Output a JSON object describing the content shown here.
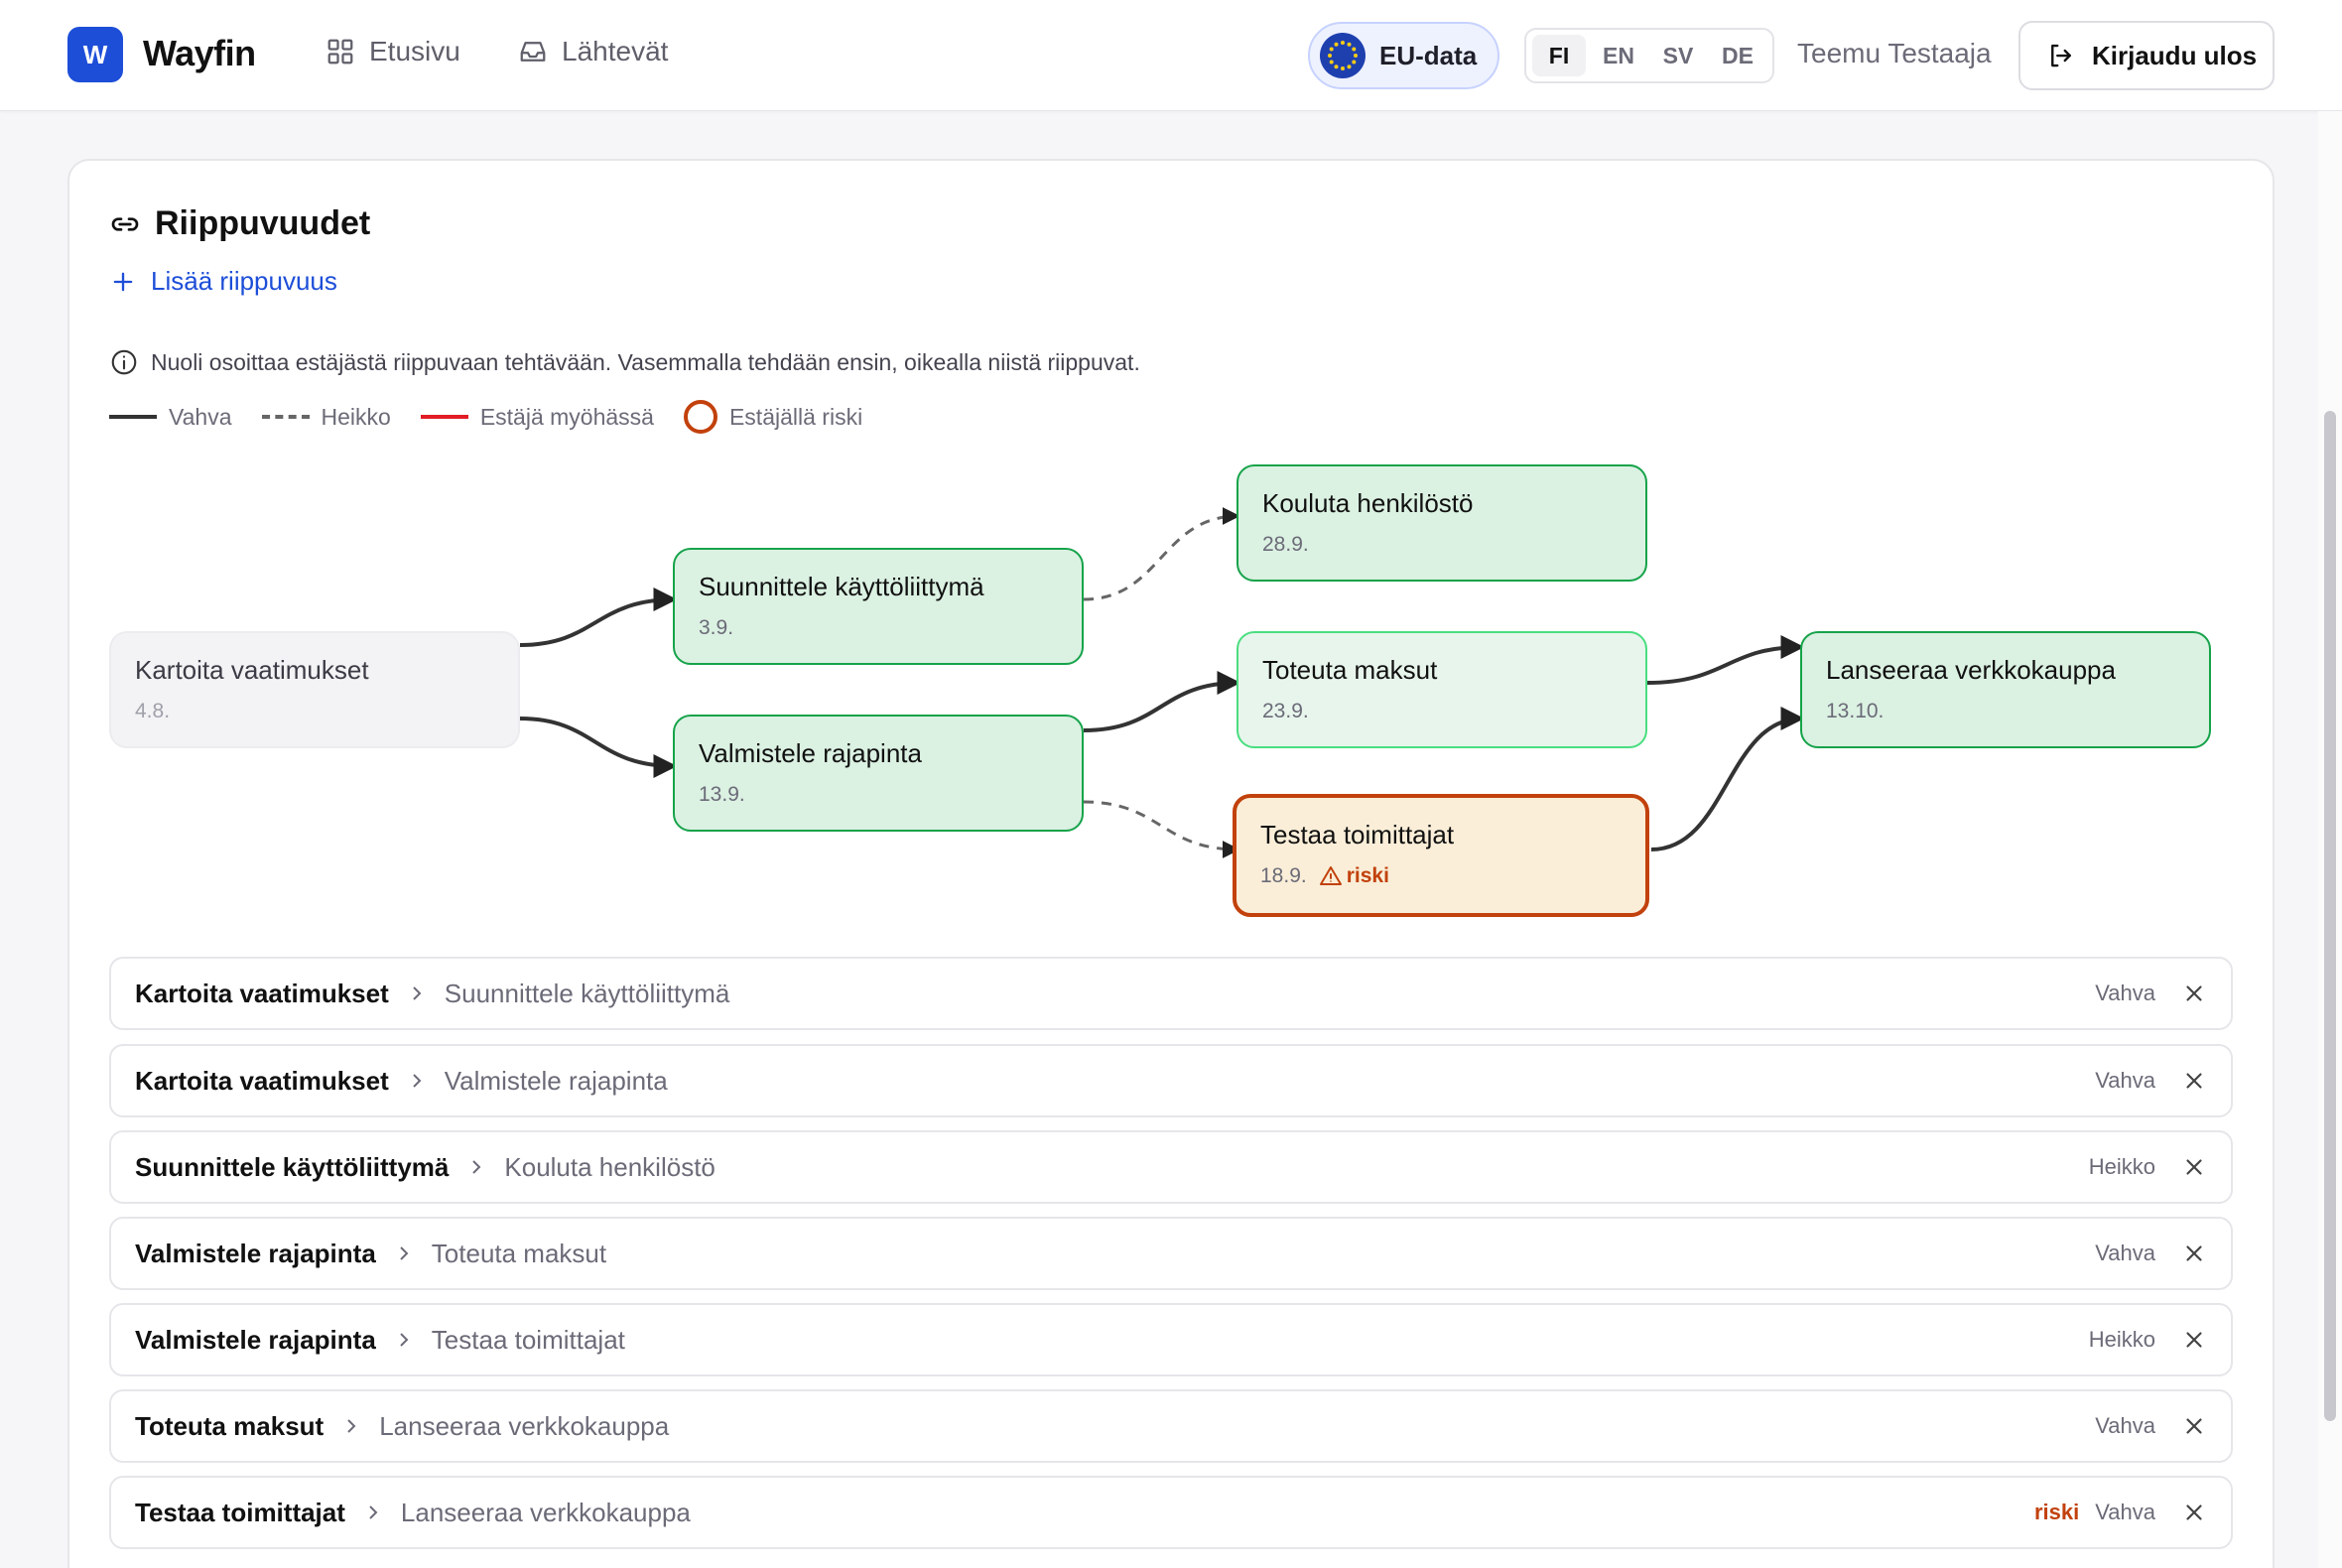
{
  "header": {
    "logo_letter": "W",
    "brand": "Wayfin",
    "nav": [
      {
        "label": "Etusivu",
        "icon": "grid-icon"
      },
      {
        "label": "Lähtevät",
        "icon": "inbox-icon"
      }
    ],
    "eu_badge": "EU-data",
    "languages": [
      {
        "code": "FI",
        "active": true
      },
      {
        "code": "EN",
        "active": false
      },
      {
        "code": "SV",
        "active": false
      },
      {
        "code": "DE",
        "active": false
      }
    ],
    "user_name": "Teemu Testaaja",
    "logout_label": "Kirjaudu ulos"
  },
  "section": {
    "title": "Riippuvuudet",
    "add_label": "Lisää riippuvuus",
    "info_text": "Nuoli osoittaa estäjästä riippuvaan tehtävään. Vasemmalla tehdään ensin, oikealla niistä riippuvat.",
    "legend": {
      "strong": "Vahva",
      "weak": "Heikko",
      "late": "Estäjä myöhässä",
      "risk": "Estäjällä riski"
    }
  },
  "graph": {
    "nodes": [
      {
        "id": "kartoita",
        "title": "Kartoita vaatimukset",
        "date": "4.8.",
        "status": "done"
      },
      {
        "id": "suunnittele",
        "title": "Suunnittele käyttöliittymä",
        "date": "3.9.",
        "status": "ok"
      },
      {
        "id": "valmistele",
        "title": "Valmistele rajapinta",
        "date": "13.9.",
        "status": "ok"
      },
      {
        "id": "kouluta",
        "title": "Kouluta henkilöstö",
        "date": "28.9.",
        "status": "ok"
      },
      {
        "id": "toteuta",
        "title": "Toteuta maksut",
        "date": "23.9.",
        "status": "light"
      },
      {
        "id": "testaa",
        "title": "Testaa toimittajat",
        "date": "18.9.",
        "status": "risk",
        "risk_label": "riski"
      },
      {
        "id": "lanseeraa",
        "title": "Lanseeraa verkkokauppa",
        "date": "13.10.",
        "status": "ok"
      }
    ]
  },
  "dependencies": [
    {
      "from": "Kartoita vaatimukset",
      "to": "Suunnittele käyttöliittymä",
      "type": "Vahva",
      "risk": ""
    },
    {
      "from": "Kartoita vaatimukset",
      "to": "Valmistele rajapinta",
      "type": "Vahva",
      "risk": ""
    },
    {
      "from": "Suunnittele käyttöliittymä",
      "to": "Kouluta henkilöstö",
      "type": "Heikko",
      "risk": ""
    },
    {
      "from": "Valmistele rajapinta",
      "to": "Toteuta maksut",
      "type": "Vahva",
      "risk": ""
    },
    {
      "from": "Valmistele rajapinta",
      "to": "Testaa toimittajat",
      "type": "Heikko",
      "risk": ""
    },
    {
      "from": "Toteuta maksut",
      "to": "Lanseeraa verkkokauppa",
      "type": "Vahva",
      "risk": ""
    },
    {
      "from": "Testaa toimittajat",
      "to": "Lanseeraa verkkokauppa",
      "type": "Vahva",
      "risk": "riski"
    }
  ],
  "colors": {
    "accent": "#1d4ed8",
    "node_border": "#16a34a",
    "node_fill": "#dbf1e2",
    "risk": "#c2410c",
    "late": "#e11d24"
  }
}
